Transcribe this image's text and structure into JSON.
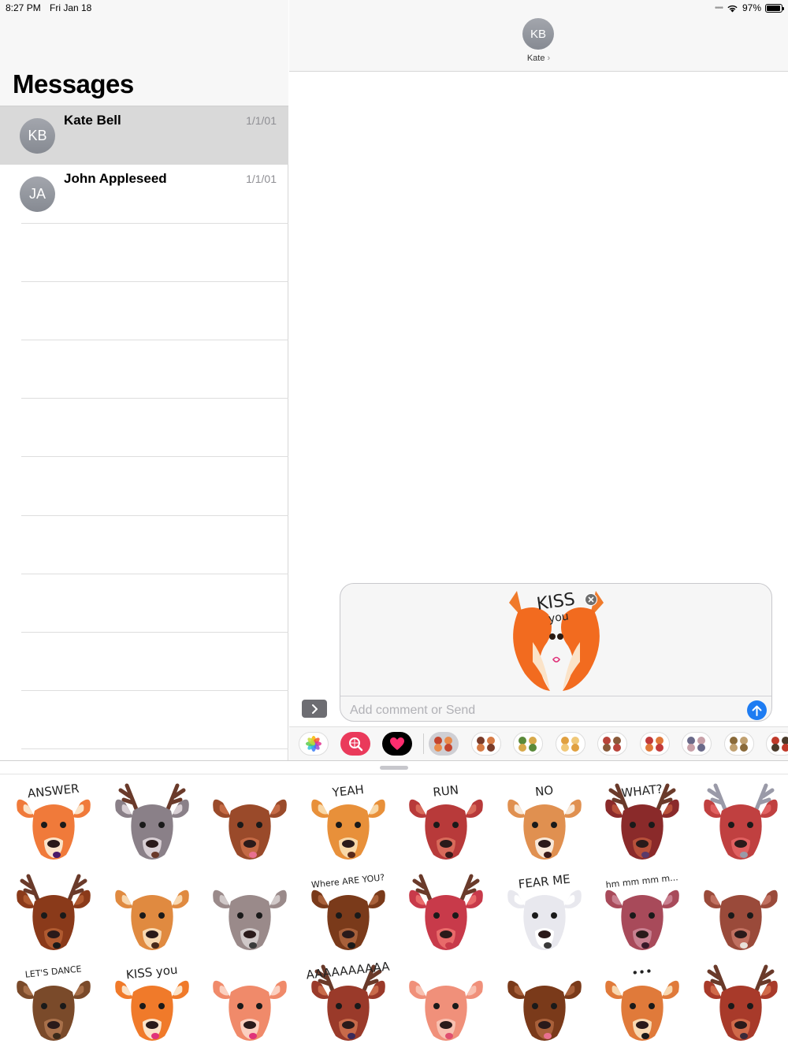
{
  "status_bar": {
    "time": "8:27 PM",
    "date": "Fri Jan 18",
    "battery_text": "97%",
    "battery_level": 0.97
  },
  "sidebar": {
    "title": "Messages",
    "conversations": [
      {
        "initials": "KB",
        "name": "Kate Bell",
        "date": "1/1/01",
        "selected": true
      },
      {
        "initials": "JA",
        "name": "John Appleseed",
        "date": "1/1/01",
        "selected": false
      }
    ]
  },
  "conversation": {
    "contact_initials": "KB",
    "contact_name": "Kate",
    "contact_chevron": "›",
    "compose_placeholder": "Add comment or Send",
    "attached_sticker": {
      "caption_line1": "KISS",
      "caption_line2": "you",
      "icon": "kissing-deer-sticker"
    }
  },
  "app_strip": {
    "apps": [
      {
        "name": "photos-app-icon"
      },
      {
        "name": "image-search-app-icon"
      },
      {
        "name": "digital-touch-heart-icon"
      }
    ],
    "sticker_pack_count": 9
  },
  "stickers": [
    {
      "id": "answer",
      "caption": "ANSWER",
      "icon": "deer-answer-phone-sticker"
    },
    {
      "id": "antler-grin",
      "caption": "",
      "icon": "deer-antlers-grin-sticker"
    },
    {
      "id": "tongue-out",
      "caption": "",
      "icon": "deer-tongue-out-sticker"
    },
    {
      "id": "yeah",
      "caption": "YEAH",
      "icon": "deer-yeah-sticker"
    },
    {
      "id": "run",
      "caption": "RUN",
      "icon": "deer-run-sticker"
    },
    {
      "id": "no-no-no",
      "caption": "NO",
      "icon": "deer-no-no-sticker"
    },
    {
      "id": "what",
      "caption": "WHAT?",
      "icon": "deer-what-sticker"
    },
    {
      "id": "grey-antlers",
      "caption": "",
      "icon": "deer-grey-antlers-sticker"
    },
    {
      "id": "dark-deer",
      "caption": "",
      "icon": "deer-dark-face-sticker"
    },
    {
      "id": "spotted-fawn",
      "caption": "",
      "icon": "deer-spotted-fawn-sticker"
    },
    {
      "id": "grey-smile",
      "caption": "",
      "icon": "deer-grey-smile-sticker"
    },
    {
      "id": "where-are-you",
      "caption": "Where ARE YOU?",
      "icon": "deer-where-are-you-sticker"
    },
    {
      "id": "red-stag",
      "caption": "",
      "icon": "deer-red-stag-sticker"
    },
    {
      "id": "fear-me",
      "caption": "FEAR ME",
      "icon": "deer-fear-me-sticker"
    },
    {
      "id": "hmm",
      "caption": "hm mm mm m...",
      "icon": "deer-hmm-sticker"
    },
    {
      "id": "grumpy",
      "caption": "",
      "icon": "deer-grumpy-sticker"
    },
    {
      "id": "lets-dance",
      "caption": "LET'S DANCE",
      "icon": "deer-lets-dance-sticker"
    },
    {
      "id": "kiss-you",
      "caption": "KISS you",
      "icon": "deer-kiss-you-sticker"
    },
    {
      "id": "fawn-tongue",
      "caption": "",
      "icon": "deer-fawn-tongue-sticker"
    },
    {
      "id": "scream",
      "caption": "AAAAAAAAAA",
      "icon": "deer-scream-sticker"
    },
    {
      "id": "upside-down",
      "caption": "",
      "icon": "deer-upside-down-sticker"
    },
    {
      "id": "brown-tongue",
      "caption": "",
      "icon": "deer-brown-tongue-sticker"
    },
    {
      "id": "ellipsis",
      "caption": "•••",
      "icon": "deer-ellipsis-sticker"
    },
    {
      "id": "stag-tongue",
      "caption": "",
      "icon": "deer-stag-tongue-sticker"
    }
  ],
  "colors": {
    "accent": "#1e7cf2",
    "selected_row": "#d9d9d9",
    "avatar": "#94979e",
    "search_app": "#ea3a5b"
  }
}
